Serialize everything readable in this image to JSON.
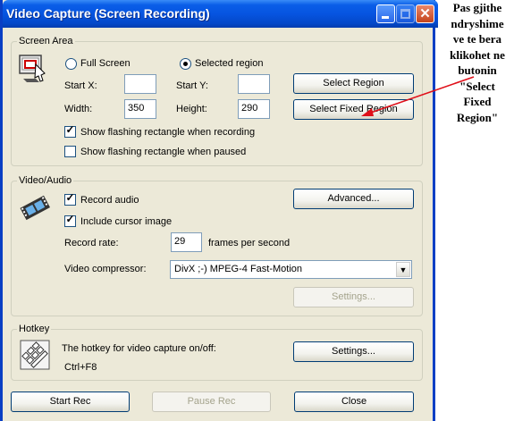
{
  "window": {
    "title": "Video Capture (Screen Recording)",
    "close_glyph": "✕"
  },
  "screen_area": {
    "group_label": "Screen Area",
    "mode_options": [
      "Full Screen",
      "Selected region"
    ],
    "selected_mode": "Selected region",
    "start_x_label": "Start X:",
    "start_x_value": "",
    "start_y_label": "Start Y:",
    "start_y_value": "",
    "width_label": "Width:",
    "width_value": "350",
    "height_label": "Height:",
    "height_value": "290",
    "select_region_button": "Select Region",
    "select_fixed_region_button": "Select Fixed Region",
    "show_flash_recording_label": "Show flashing rectangle when recording",
    "show_flash_recording_checked": true,
    "show_flash_paused_label": "Show flashing rectangle when paused",
    "show_flash_paused_checked": false
  },
  "video_audio": {
    "group_label": "Video/Audio",
    "record_audio_label": "Record audio",
    "record_audio_checked": true,
    "include_cursor_label": "Include cursor image",
    "include_cursor_checked": true,
    "advanced_button": "Advanced...",
    "record_rate_label": "Record rate:",
    "record_rate_value": "29",
    "record_rate_unit": "frames per second",
    "compressor_label": "Video compressor:",
    "compressor_value": "DivX ;-) MPEG-4 Fast-Motion",
    "settings_button": "Settings..."
  },
  "hotkey": {
    "group_label": "Hotkey",
    "description": "The hotkey for video capture on/off:",
    "keys": "Ctrl+F8",
    "settings_button": "Settings..."
  },
  "footer": {
    "start_button": "Start Rec",
    "pause_button": "Pause Rec",
    "close_button": "Close"
  },
  "annotation": {
    "text": "Pas gjithe\nndryshime\nve te bera\nklikohet ne\nbutonin\n\"Select\nFixed\nRegion\"",
    "arrow_color": "#e0101a"
  },
  "icons": {
    "title_minimize": "minimize-icon",
    "title_maximize": "maximize-icon",
    "title_close": "close-icon",
    "screen_area": "screen-selection-icon",
    "video_audio": "film-camera-icon",
    "hotkey": "keyboard-icon"
  },
  "colors": {
    "title_bar": "#0654e0",
    "dialog_bg": "#ece9d8",
    "annotation_arrow": "#e0101a"
  }
}
